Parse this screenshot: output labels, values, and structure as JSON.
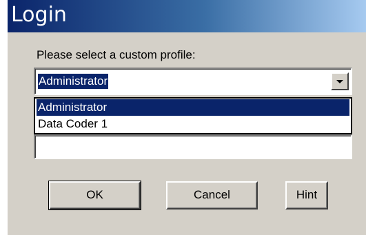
{
  "window": {
    "title": "Login"
  },
  "form": {
    "prompt": "Please select a custom profile:",
    "profile_select": {
      "selected": "Administrator",
      "options": [
        "Administrator",
        "Data Coder 1"
      ],
      "highlighted_index": 0
    },
    "password_value": ""
  },
  "buttons": {
    "ok": "OK",
    "cancel": "Cancel",
    "hint": "Hint"
  },
  "colors": {
    "selection": "#0a246a",
    "face": "#d4d0c8",
    "title_gradient_start": "#0a246a",
    "title_gradient_end": "#a6caf0"
  }
}
